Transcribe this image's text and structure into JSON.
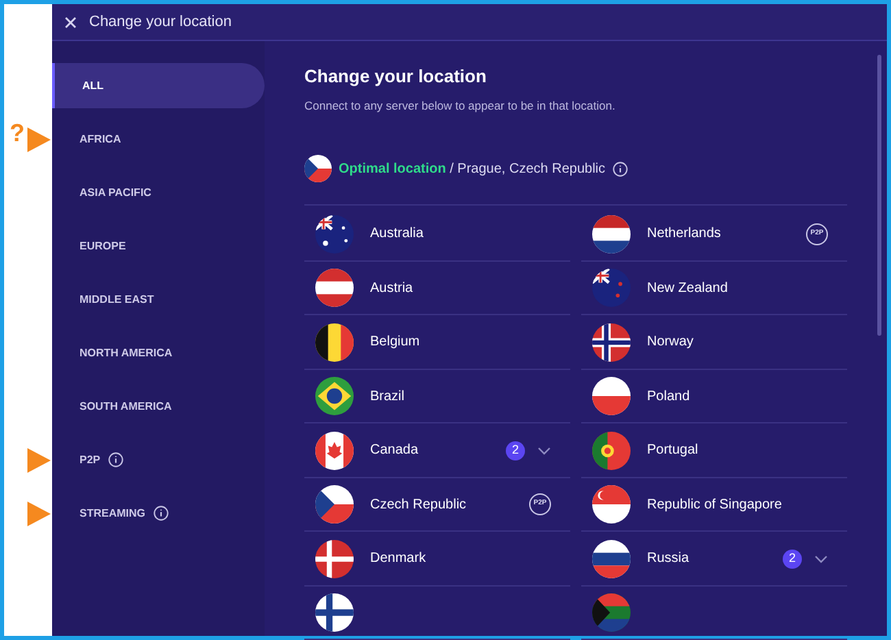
{
  "window": {
    "title": "Change your location"
  },
  "sidebar": {
    "items": [
      {
        "label": "ALL",
        "selected": true,
        "arrow": false
      },
      {
        "label": "AFRICA",
        "selected": false,
        "arrow": true,
        "note": "?"
      },
      {
        "label": "ASIA PACIFIC",
        "selected": false,
        "arrow": false
      },
      {
        "label": "EUROPE",
        "selected": false,
        "arrow": false
      },
      {
        "label": "MIDDLE EAST",
        "selected": false,
        "arrow": false
      },
      {
        "label": "NORTH AMERICA",
        "selected": false,
        "arrow": false
      },
      {
        "label": "SOUTH AMERICA",
        "selected": false,
        "arrow": false
      },
      {
        "label": "P2P",
        "selected": false,
        "arrow": true,
        "info": true
      },
      {
        "label": "STREAMING",
        "selected": false,
        "arrow": true,
        "info": true
      }
    ]
  },
  "content": {
    "heading": "Change your location",
    "subtitle": "Connect to any server below to appear to be in that location.",
    "optimal": {
      "label": "Optimal location",
      "location": "/ Prague, Czech Republic",
      "kind": "cz"
    },
    "countries": [
      [
        {
          "name": "Australia",
          "kind": "au"
        },
        {
          "name": "Netherlands",
          "kind": "nl",
          "badge": {
            "kind": "p2p",
            "text": "P2P"
          }
        }
      ],
      [
        {
          "name": "Austria",
          "kind": "at"
        },
        {
          "name": "New Zealand",
          "kind": "nz"
        }
      ],
      [
        {
          "name": "Belgium",
          "kind": "be"
        },
        {
          "name": "Norway",
          "kind": "no"
        }
      ],
      [
        {
          "name": "Brazil",
          "kind": "br"
        },
        {
          "name": "Poland",
          "kind": "pl"
        }
      ],
      [
        {
          "name": "Canada",
          "kind": "ca",
          "badge": {
            "kind": "count",
            "text": "2"
          }
        },
        {
          "name": "Portugal",
          "kind": "pt"
        }
      ],
      [
        {
          "name": "Czech Republic",
          "kind": "cz",
          "badge": {
            "kind": "p2p",
            "text": "P2P"
          }
        },
        {
          "name": "Republic of Singapore",
          "kind": "sg"
        }
      ],
      [
        {
          "name": "Denmark",
          "kind": "dk"
        },
        {
          "name": "Russia",
          "kind": "ru",
          "badge": {
            "kind": "count",
            "text": "2"
          }
        }
      ],
      [
        {
          "kind": "fi"
        },
        {
          "kind": "za"
        }
      ]
    ]
  }
}
